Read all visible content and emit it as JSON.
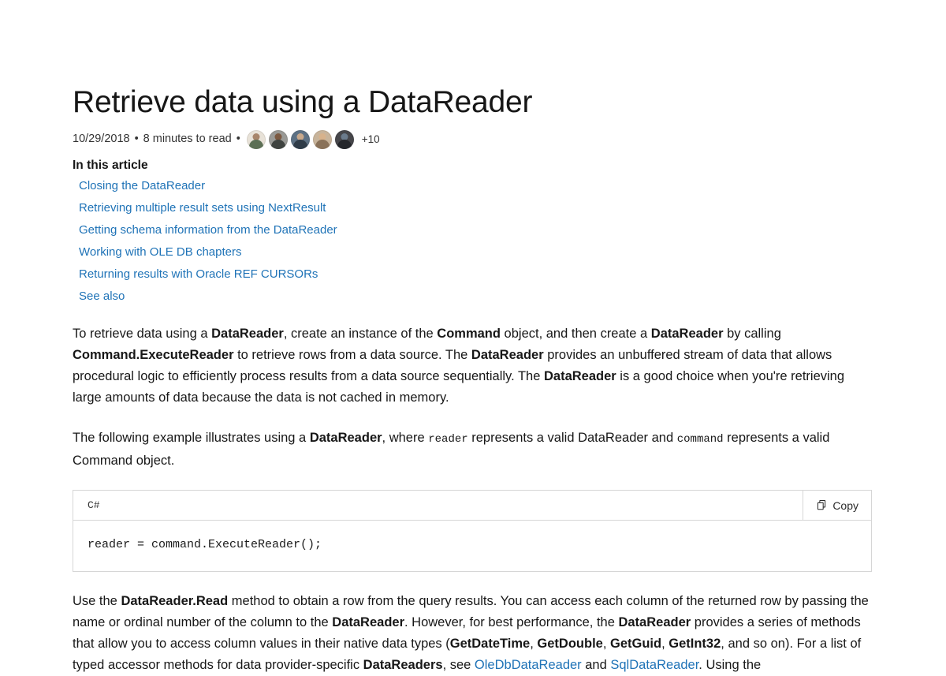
{
  "article": {
    "title": "Retrieve data using a DataReader",
    "meta": {
      "date": "10/29/2018",
      "read_time": "8 minutes to read",
      "separator": "•",
      "extra_contributors": "+10",
      "avatar_count": 5
    },
    "toc_heading": "In this article",
    "toc": [
      {
        "label": "Closing the DataReader"
      },
      {
        "label": "Retrieving multiple result sets using NextResult"
      },
      {
        "label": "Getting schema information from the DataReader"
      },
      {
        "label": "Working with OLE DB chapters"
      },
      {
        "label": "Returning results with Oracle REF CURSORs"
      },
      {
        "label": "See also"
      }
    ],
    "paragraph1": {
      "s1": "To retrieve data using a ",
      "b1": "DataReader",
      "s2": ", create an instance of the ",
      "b2": "Command",
      "s3": " object, and then create a ",
      "b3": "DataReader",
      "s4": " by calling ",
      "b4": "Command.ExecuteReader",
      "s5": " to retrieve rows from a data source. The ",
      "b5": "DataReader",
      "s6": " provides an unbuffered stream of data that allows procedural logic to efficiently process results from a data source sequentially. The ",
      "b6": "DataReader",
      "s7": " is a good choice when you're retrieving large amounts of data because the data is not cached in memory."
    },
    "paragraph2": {
      "s1": "The following example illustrates using a ",
      "b1": "DataReader",
      "s2": ", where ",
      "code1": "reader",
      "s3": " represents a valid DataReader and ",
      "code2": "command",
      "s4": " represents a valid Command object."
    },
    "code_block": {
      "language": "C#",
      "copy_label": "Copy",
      "copy_icon": "copy-icon",
      "code": "reader = command.ExecuteReader();"
    },
    "paragraph3": {
      "s1": "Use the ",
      "b1": "DataReader.Read",
      "s2": " method to obtain a row from the query results. You can access each column of the returned row by passing the name or ordinal number of the column to the ",
      "b2": "DataReader",
      "s3": ". However, for best performance, the ",
      "b3": "DataReader",
      "s4": " provides a series of methods that allow you to access column values in their native data types (",
      "b4": "GetDateTime",
      "s5": ", ",
      "b5": "GetDouble",
      "s6": ", ",
      "b6": "GetGuid",
      "s7": ", ",
      "b7": "GetInt32",
      "s8": ", and so on). For a list of typed accessor methods for data provider-specific ",
      "b8": "DataReaders",
      "s9": ", see ",
      "link1": "OleDbDataReader",
      "s10": " and ",
      "link2": "SqlDataReader",
      "s11": ". Using the"
    }
  },
  "colors": {
    "link": "#1f73b7",
    "text": "#171717",
    "meta_text": "#333333",
    "border": "#d6d6d6"
  }
}
